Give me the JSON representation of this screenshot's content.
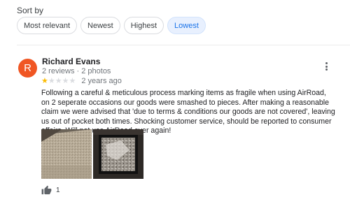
{
  "sort": {
    "label": "Sort by",
    "options": [
      "Most relevant",
      "Newest",
      "Highest",
      "Lowest"
    ],
    "selected": "Lowest"
  },
  "review": {
    "avatar_letter": "R",
    "avatar_color": "#f05623",
    "reviewer_name": "Richard Evans",
    "reviewer_meta": "2 reviews · 2 photos",
    "rating": 1,
    "max_rating": 5,
    "date": "2 years ago",
    "text": "Following a careful & meticulous process marking items as fragile when using AirRoad, on 2 seperate occasions our goods were smashed to pieces. After making a reasonable claim we were advised that 'due to terms & conditions our goods are not covered', leaving us out of pocket both times. Shocking customer service, should be reported to consumer affairs. Will not use AirRoad ever again!",
    "like_count": "1"
  },
  "icons": {
    "more": "more-vert-icon",
    "like": "thumb-up-icon",
    "star": "star-icon"
  },
  "colors": {
    "accent": "#1a73e8",
    "star_on": "#fbbc04",
    "star_off": "#dadce0"
  }
}
